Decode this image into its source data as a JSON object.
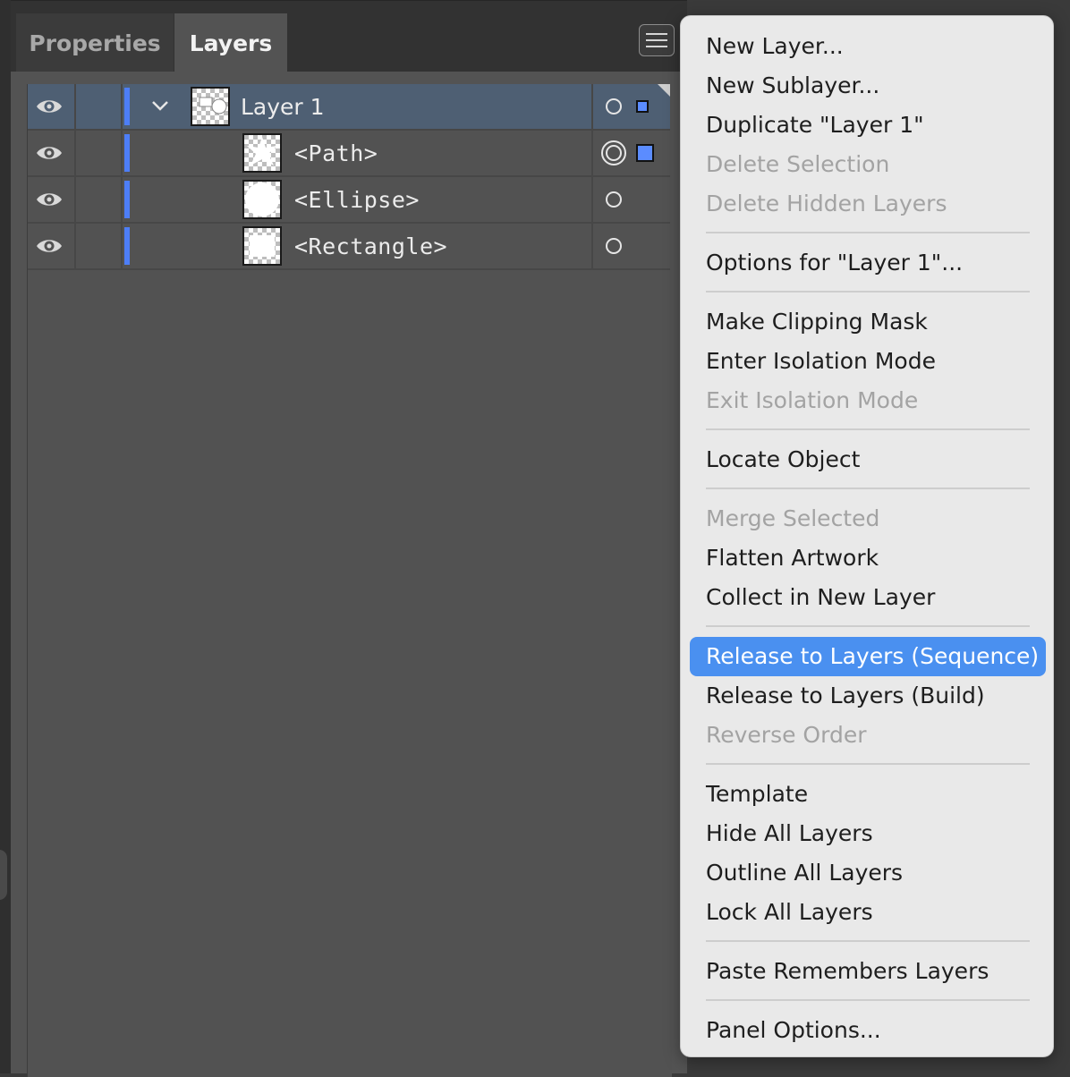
{
  "tabs": [
    {
      "label": "Properties",
      "active": false
    },
    {
      "label": "Layers",
      "active": true
    }
  ],
  "layers": [
    {
      "name": "Layer 1",
      "selected": true,
      "expanded": true
    },
    {
      "name": "<Path>",
      "selected": false
    },
    {
      "name": "<Ellipse>",
      "selected": false
    },
    {
      "name": "<Rectangle>",
      "selected": false
    }
  ],
  "menu": {
    "items": [
      {
        "label": "New Layer...",
        "enabled": true
      },
      {
        "label": "New Sublayer...",
        "enabled": true
      },
      {
        "label": "Duplicate \"Layer 1\"",
        "enabled": true
      },
      {
        "label": "Delete Selection",
        "enabled": false
      },
      {
        "label": "Delete Hidden Layers",
        "enabled": false
      },
      {
        "label": "Options for \"Layer 1\"...",
        "enabled": true
      },
      {
        "label": "Make Clipping Mask",
        "enabled": true
      },
      {
        "label": "Enter Isolation Mode",
        "enabled": true
      },
      {
        "label": "Exit Isolation Mode",
        "enabled": false
      },
      {
        "label": "Locate Object",
        "enabled": true
      },
      {
        "label": "Merge Selected",
        "enabled": false
      },
      {
        "label": "Flatten Artwork",
        "enabled": true
      },
      {
        "label": "Collect in New Layer",
        "enabled": true
      },
      {
        "label": "Release to Layers (Sequence)",
        "enabled": true,
        "highlighted": true
      },
      {
        "label": "Release to Layers (Build)",
        "enabled": true
      },
      {
        "label": "Reverse Order",
        "enabled": false
      },
      {
        "label": "Template",
        "enabled": true
      },
      {
        "label": "Hide All Layers",
        "enabled": true
      },
      {
        "label": "Outline All Layers",
        "enabled": true
      },
      {
        "label": "Lock All Layers",
        "enabled": true
      },
      {
        "label": "Paste Remembers Layers",
        "enabled": true
      },
      {
        "label": "Panel Options...",
        "enabled": true
      }
    ]
  },
  "colors": {
    "layer_color": "#4d7ef7",
    "menu_highlight": "#4a90f0",
    "selected_row": "#4e5f73"
  },
  "icons": [
    "eye-icon",
    "chevron-down-icon",
    "target-icon",
    "panel-menu-icon",
    "selection-square-icon"
  ]
}
